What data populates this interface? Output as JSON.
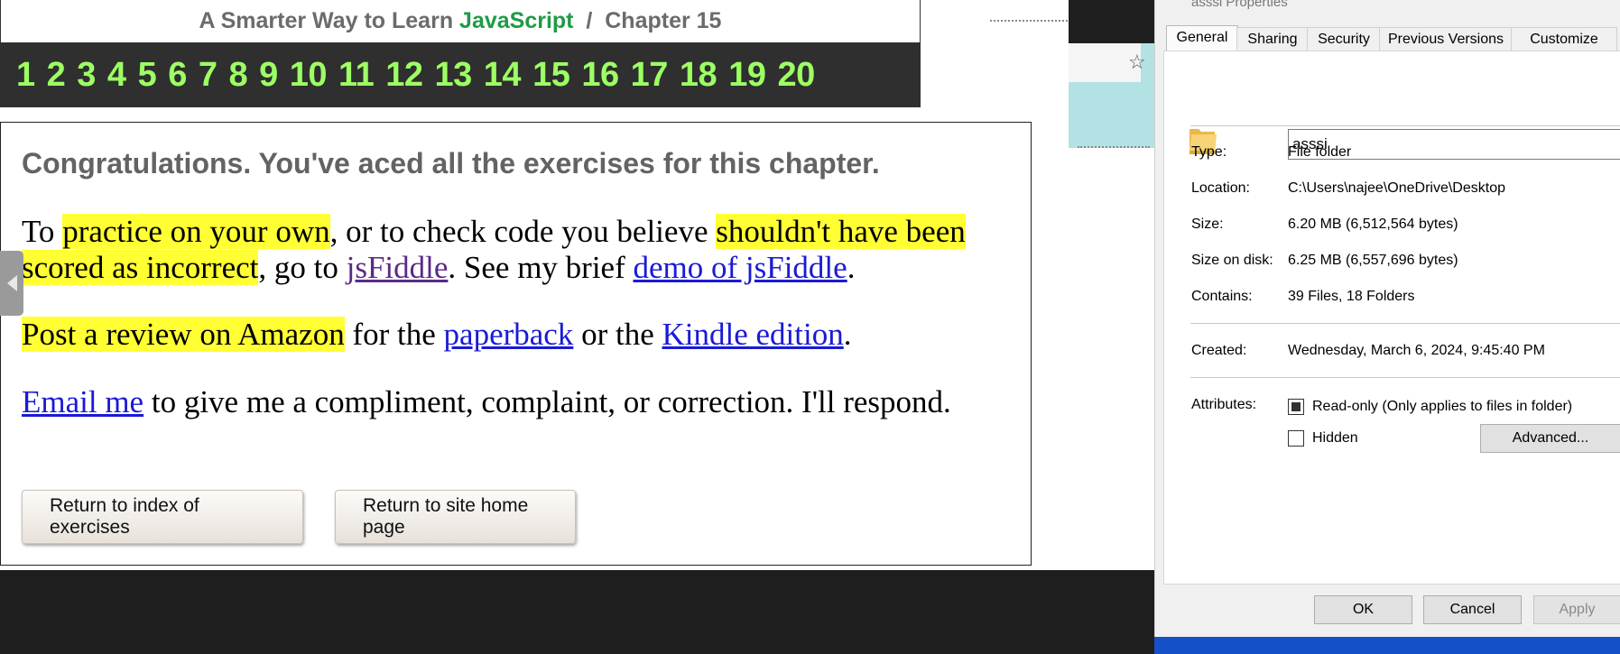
{
  "web": {
    "header_prefix": "A Smarter Way to Learn ",
    "header_accent": "JavaScript",
    "header_suffix": "  /  Chapter 15",
    "chapters": [
      "1",
      "2",
      "3",
      "4",
      "5",
      "6",
      "7",
      "8",
      "9",
      "10",
      "11",
      "12",
      "13",
      "14",
      "15",
      "16",
      "17",
      "18",
      "19",
      "20"
    ],
    "congrats": "Congratulations. You've aced all the exercises for this chapter.",
    "p1": {
      "a": "To ",
      "hl1": "practice on your own",
      "b": ", or to check code you believe ",
      "hl2": "shouldn't have been scored as incorrect",
      "c": ", go to ",
      "link1": "jsFiddle",
      "d": ". See my brief ",
      "link2": "demo of jsFiddle",
      "e": "."
    },
    "p2": {
      "hl": "Post a review on Amazon",
      "a": " for the ",
      "link1": "paperback",
      "b": " or the ",
      "link2": "Kindle edition",
      "c": "."
    },
    "p3": {
      "link": "Email me",
      "a": " to give me a compliment, complaint, or correction. I'll respond."
    },
    "btn_index": "Return to index of exercises",
    "btn_home": "Return to site home page"
  },
  "browser": {
    "star_icon": "star-icon"
  },
  "dialog": {
    "title": "asssi Properties",
    "tabs": [
      "General",
      "Sharing",
      "Security",
      "Previous Versions",
      "Customize"
    ],
    "active_tab": "General",
    "name": "asssi",
    "props": [
      {
        "label": "Type:",
        "value": "File folder"
      },
      {
        "label": "Location:",
        "value": "C:\\Users\\najee\\OneDrive\\Desktop"
      },
      {
        "label": "Size:",
        "value": "6.20 MB (6,512,564 bytes)"
      },
      {
        "label": "Size on disk:",
        "value": "6.25 MB (6,557,696 bytes)"
      },
      {
        "label": "Contains:",
        "value": "39 Files, 18 Folders"
      }
    ],
    "created_label": "Created:",
    "created_value": "Wednesday, March 6, 2024, 9:45:40 PM",
    "attributes_label": "Attributes:",
    "readonly_label": "Read-only (Only applies to files in folder)",
    "hidden_label": "Hidden",
    "advanced": "Advanced...",
    "ok": "OK",
    "cancel": "Cancel",
    "apply": "Apply"
  },
  "colors": {
    "highlight": "#ffff33",
    "chapter_nav_text": "#9cff63",
    "accent_green": "#1f9b45",
    "link_blue": "#1a1ad6",
    "taskbar_blue": "#1450c8"
  }
}
